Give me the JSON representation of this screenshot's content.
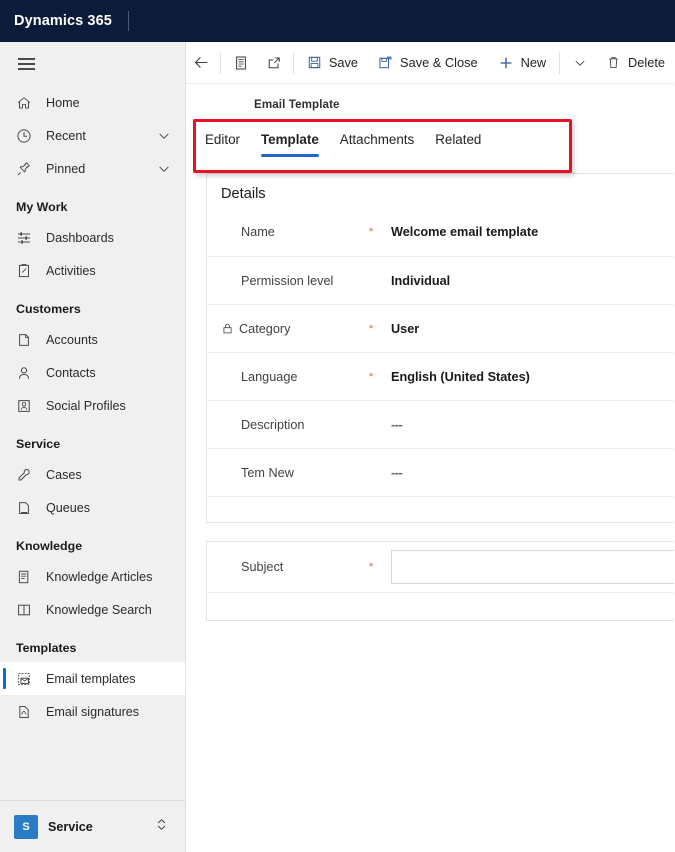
{
  "topbar": {
    "title": "Dynamics 365"
  },
  "sidebar": {
    "hamburger_name": "site-map-toggle",
    "items": [
      {
        "type": "item",
        "label": "Home",
        "icon": "home-icon"
      },
      {
        "type": "item",
        "label": "Recent",
        "icon": "clock-icon",
        "chevron": true
      },
      {
        "type": "item",
        "label": "Pinned",
        "icon": "pin-icon",
        "chevron": true
      },
      {
        "type": "group",
        "label": "My Work"
      },
      {
        "type": "item",
        "label": "Dashboards",
        "icon": "dashboard-icon"
      },
      {
        "type": "item",
        "label": "Activities",
        "icon": "activities-icon"
      },
      {
        "type": "group",
        "label": "Customers"
      },
      {
        "type": "item",
        "label": "Accounts",
        "icon": "accounts-icon"
      },
      {
        "type": "item",
        "label": "Contacts",
        "icon": "contact-icon"
      },
      {
        "type": "item",
        "label": "Social Profiles",
        "icon": "social-profile-icon"
      },
      {
        "type": "group",
        "label": "Service"
      },
      {
        "type": "item",
        "label": "Cases",
        "icon": "case-icon"
      },
      {
        "type": "item",
        "label": "Queues",
        "icon": "queue-icon"
      },
      {
        "type": "group",
        "label": "Knowledge"
      },
      {
        "type": "item",
        "label": "Knowledge Articles",
        "icon": "article-icon"
      },
      {
        "type": "item",
        "label": "Knowledge Search",
        "icon": "book-icon"
      },
      {
        "type": "group",
        "label": "Templates"
      },
      {
        "type": "item",
        "label": "Email templates",
        "icon": "email-template-icon",
        "selected": true
      },
      {
        "type": "item",
        "label": "Email signatures",
        "icon": "signature-icon"
      }
    ],
    "footer": {
      "badge": "S",
      "app_name": "Service",
      "switcher_icon": "app-switcher-icon"
    }
  },
  "commandbar": {
    "back_icon": "back-arrow-icon",
    "form_selector_icon": "form-selector-icon",
    "popout_icon": "open-in-new-window-icon",
    "save_label": "Save",
    "save_icon": "save-icon",
    "save_close_label": "Save & Close",
    "save_close_icon": "save-and-close-icon",
    "new_label": "New",
    "new_icon": "plus-icon",
    "overflow_icon": "chevron-down-icon",
    "delete_label": "Delete",
    "delete_icon": "trash-icon"
  },
  "form": {
    "entity_label": "Email Template",
    "tabs": [
      {
        "label": "Editor",
        "active": false
      },
      {
        "label": "Template",
        "active": true
      },
      {
        "label": "Attachments",
        "active": false
      },
      {
        "label": "Related",
        "active": false
      }
    ],
    "highlight_color": "#e81123",
    "accent_color": "#1f68c9",
    "details": {
      "section_title": "Details",
      "fields": [
        {
          "label": "Name",
          "value": "Welcome email template",
          "required": true,
          "locked": false
        },
        {
          "label": "Permission level",
          "value": "Individual",
          "required": false,
          "locked": false
        },
        {
          "label": "Category",
          "value": "User",
          "required": true,
          "locked": true
        },
        {
          "label": "Language",
          "value": "English (United States)",
          "required": true,
          "locked": false
        },
        {
          "label": "Description",
          "value": "---",
          "required": false,
          "locked": false
        },
        {
          "label": "Tem New",
          "value": "---",
          "required": false,
          "locked": false
        }
      ]
    },
    "subject": {
      "label": "Subject",
      "required": true,
      "value": "",
      "placeholder": ""
    }
  }
}
